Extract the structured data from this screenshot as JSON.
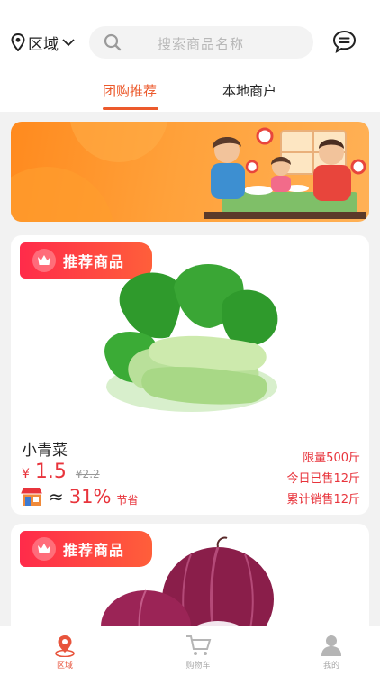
{
  "header": {
    "region_label": "区域",
    "search_placeholder": "搜索商品名称"
  },
  "tabs": [
    {
      "label": "团购推荐",
      "active": true
    },
    {
      "label": "本地商户",
      "active": false
    }
  ],
  "accent_color": "#ec5a2c",
  "price_color": "#e8343c",
  "products": [
    {
      "badge": "推荐商品",
      "name": "小青菜",
      "currency": "¥",
      "price": "1.5",
      "original_price": "¥2.2",
      "approx": "≈",
      "discount": "31%",
      "discount_label": "节省",
      "limit": "限量500斤",
      "sold_today": "今日已售12斤",
      "sold_total": "累计销售12斤"
    },
    {
      "badge": "推荐商品"
    }
  ],
  "bottom_nav": [
    {
      "label": "区域",
      "icon": "location-icon",
      "active": true
    },
    {
      "label": "购物车",
      "icon": "cart-icon",
      "active": false
    },
    {
      "label": "我的",
      "icon": "user-icon",
      "active": false
    }
  ]
}
